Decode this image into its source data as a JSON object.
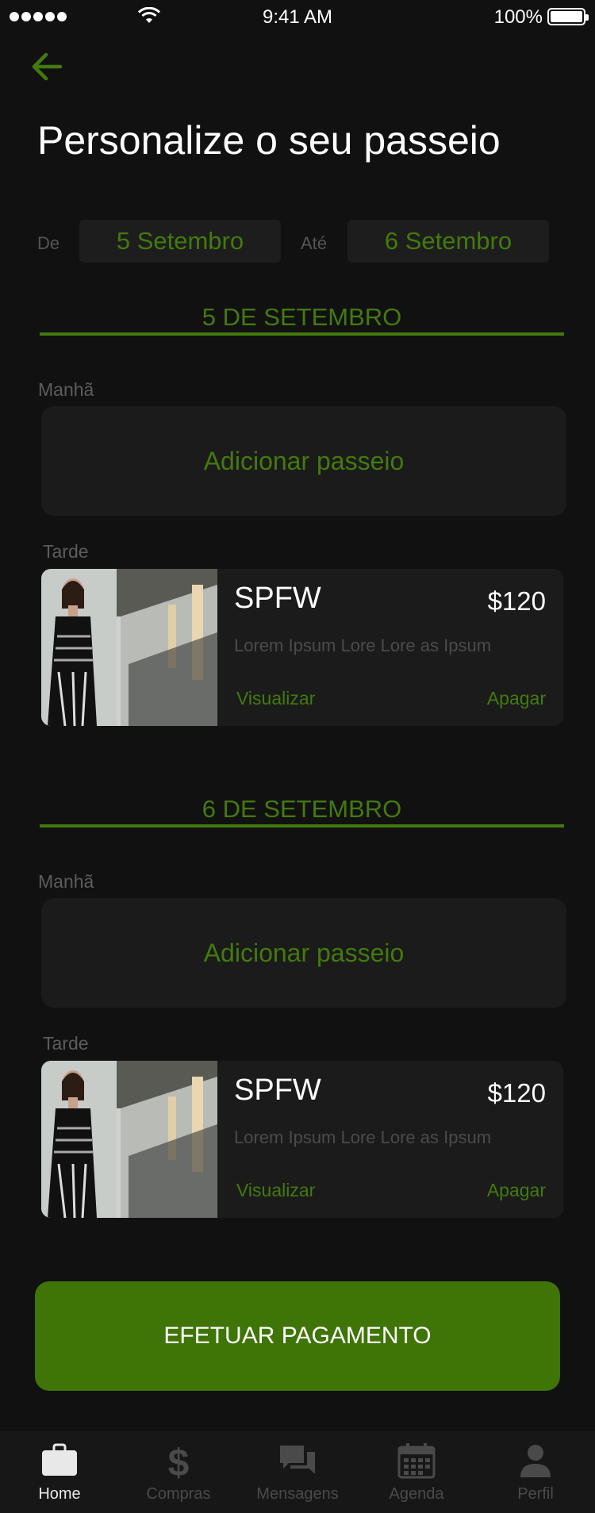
{
  "status_bar": {
    "time": "9:41 AM",
    "battery": "100%"
  },
  "header": {
    "title": "Personalize o seu passeio"
  },
  "date_range": {
    "from_label": "De",
    "from_value": "5  Setembro",
    "to_label": "Até",
    "to_value": "6 Setembro"
  },
  "days": [
    {
      "title": "5 DE SETEMBRO",
      "morning_label": "Manhã",
      "add_label": "Adicionar passeio",
      "afternoon_label": "Tarde",
      "tour": {
        "name": "SPFW",
        "price": "$120",
        "description": "Lorem Ipsum Lore Lore as Ipsum",
        "view_label": "Visualizar",
        "delete_label": "Apagar"
      }
    },
    {
      "title": "6 DE SETEMBRO",
      "morning_label": "Manhã",
      "add_label": "Adicionar passeio",
      "afternoon_label": "Tarde",
      "tour": {
        "name": "SPFW",
        "price": "$120",
        "description": "Lorem Ipsum Lore Lore as Ipsum",
        "view_label": "Visualizar",
        "delete_label": "Apagar"
      }
    }
  ],
  "pay_button": "EFETUAR PAGAMENTO",
  "tab_bar": {
    "active": "Home",
    "items": [
      {
        "label": "Home",
        "icon": "briefcase-icon"
      },
      {
        "label": "Compras",
        "icon": "dollar-icon"
      },
      {
        "label": "Mensagens",
        "icon": "chat-bubbles-icon"
      },
      {
        "label": "Agenda",
        "icon": "calendar-icon"
      },
      {
        "label": "Perfil",
        "icon": "person-icon"
      }
    ]
  },
  "colors": {
    "accent": "#437a0d",
    "button": "#3f7406",
    "background": "#111111",
    "card": "#1b1b1b"
  }
}
